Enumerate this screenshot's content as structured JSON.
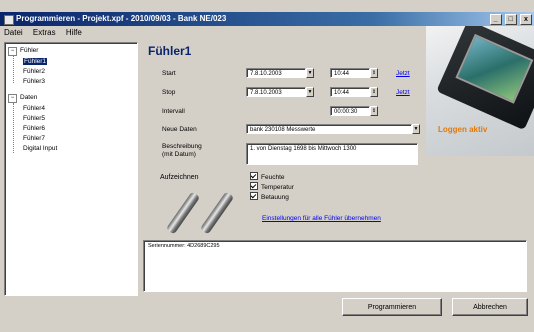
{
  "window": {
    "title": "Programmieren - Projekt.xpf - 2010/09/03 - Bank NE/023",
    "btn_min": "_",
    "btn_max": "□",
    "btn_close": "x"
  },
  "menu": [
    "Datei",
    "Extras",
    "Hilfe"
  ],
  "tree": {
    "root1": "Fühler",
    "toggle_root1": "−",
    "items1": [
      {
        "label": "Fühler1",
        "selected": true
      },
      {
        "label": "Fühler2",
        "selected": false
      },
      {
        "label": "Fühler3",
        "selected": false
      }
    ],
    "root2": "Daten",
    "toggle_root2": "−",
    "items2": [
      "Fühler4",
      "Fühler5",
      "Fühler6",
      "Fühler7",
      "Digital Input"
    ]
  },
  "panel": {
    "title": "Fühler1",
    "start_label": "Start",
    "start_date": "7.8.10.2003",
    "start_time": "10:44",
    "start_now": "Jetzt",
    "stop_label": "Stop",
    "stop_date": "7.8.10.2003",
    "stop_time": "10:44",
    "stop_now": "Jetzt",
    "interval_label": "Intervall",
    "interval_value": "00:00:30",
    "new_data_label": "Neue Daten",
    "new_data_value": "bank 230108 Messwerte",
    "logging_status": "Loggen aktiv",
    "desc_label_1": "Beschreibung",
    "desc_label_2": "(mit Datum)",
    "desc_value": "1. von Dienstag 1698 bis Mittwoch 1300",
    "record_label": "Aufzeichnen",
    "checkboxes": [
      "Feuchte",
      "Temperatur",
      "Betauung"
    ],
    "apply_all_link": "Einstellungen für alle Fühler übernehmen"
  },
  "output": {
    "text": "Seriennummer: 4D2689C295"
  },
  "buttons": {
    "program": "Programmieren",
    "cancel": "Abbrechen"
  },
  "icons": {
    "dropdown": "▼",
    "spin": "⇕"
  },
  "colors": {
    "titlebar": "#0a246a",
    "logging": "#e07a10",
    "link": "#0000ee"
  }
}
